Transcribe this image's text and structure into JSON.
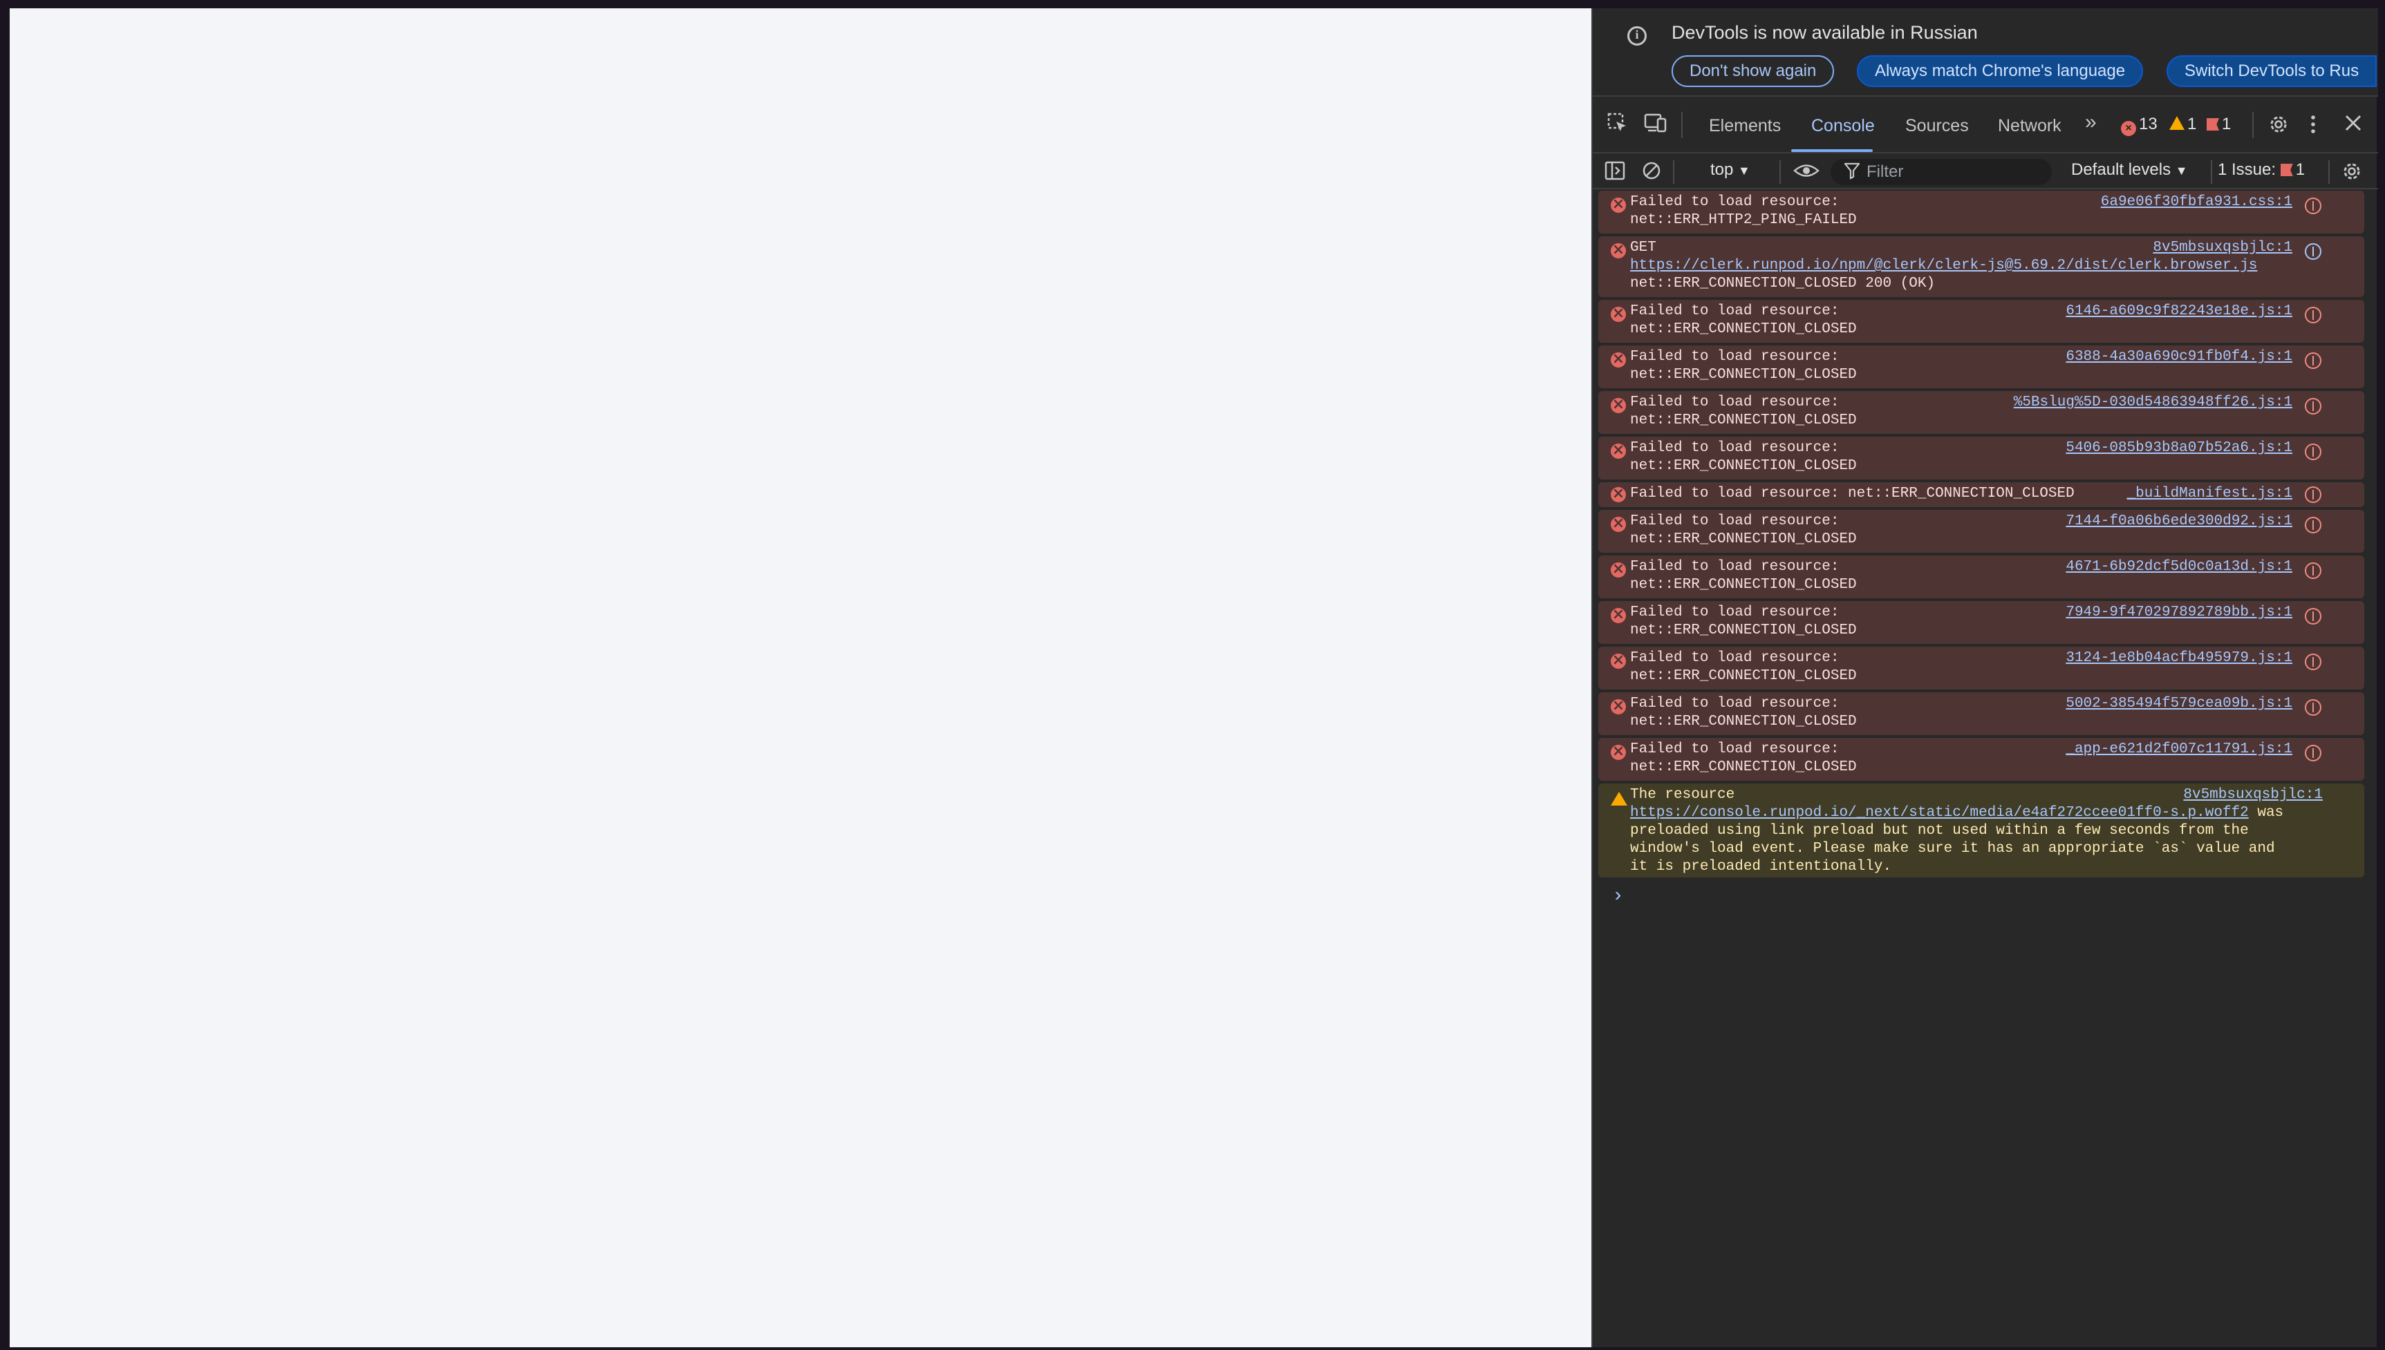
{
  "infobar": {
    "message": "DevTools is now available in Russian",
    "btn_dont_show": "Don't show again",
    "btn_match": "Always match Chrome's language",
    "btn_switch": "Switch DevTools to Rus"
  },
  "tabs": {
    "elements": "Elements",
    "console": "Console",
    "sources": "Sources",
    "network": "Network",
    "more": "»"
  },
  "counts": {
    "errors": "13",
    "warnings": "1",
    "issues": "1"
  },
  "console_toolbar": {
    "context": "top",
    "filter_placeholder": "Filter",
    "levels": "Default levels",
    "issues_label": "1 Issue:",
    "issues_count": "1"
  },
  "messages": [
    {
      "type": "error",
      "line1": "Failed to load resource:",
      "line2": "net::ERR_HTTP2_PING_FAILED",
      "source": "6a9e06f30fbfa931.css:1"
    },
    {
      "type": "error-get",
      "line1": "GET",
      "url": "https://clerk.runpod.io/npm/@clerk/clerk-js@5.69.2/dist/clerk.browser.js",
      "line3": "net::ERR_CONNECTION_CLOSED 200 (OK)",
      "source": "8v5mbsuxqsbjlc:1"
    },
    {
      "type": "error",
      "line1": "Failed to load resource:",
      "line2": "net::ERR_CONNECTION_CLOSED",
      "source": "6146-a609c9f82243e18e.js:1"
    },
    {
      "type": "error",
      "line1": "Failed to load resource:",
      "line2": "net::ERR_CONNECTION_CLOSED",
      "source": "6388-4a30a690c91fb0f4.js:1"
    },
    {
      "type": "error",
      "line1": "Failed to load resource:",
      "line2": "net::ERR_CONNECTION_CLOSED",
      "source": "%5Bslug%5D-030d54863948ff26.js:1"
    },
    {
      "type": "error",
      "line1": "Failed to load resource:",
      "line2": "net::ERR_CONNECTION_CLOSED",
      "source": "5406-085b93b8a07b52a6.js:1"
    },
    {
      "type": "error-single",
      "line1": "Failed to load resource: net::ERR_CONNECTION_CLOSED",
      "source": "_buildManifest.js:1"
    },
    {
      "type": "error",
      "line1": "Failed to load resource:",
      "line2": "net::ERR_CONNECTION_CLOSED",
      "source": "7144-f0a06b6ede300d92.js:1"
    },
    {
      "type": "error",
      "line1": "Failed to load resource:",
      "line2": "net::ERR_CONNECTION_CLOSED",
      "source": "4671-6b92dcf5d0c0a13d.js:1"
    },
    {
      "type": "error",
      "line1": "Failed to load resource:",
      "line2": "net::ERR_CONNECTION_CLOSED",
      "source": "7949-9f470297892789bb.js:1"
    },
    {
      "type": "error",
      "line1": "Failed to load resource:",
      "line2": "net::ERR_CONNECTION_CLOSED",
      "source": "3124-1e8b04acfb495979.js:1"
    },
    {
      "type": "error",
      "line1": "Failed to load resource:",
      "line2": "net::ERR_CONNECTION_CLOSED",
      "source": "5002-385494f579cea09b.js:1"
    },
    {
      "type": "error",
      "line1": "Failed to load resource:",
      "line2": "net::ERR_CONNECTION_CLOSED",
      "source": "_app-e621d2f007c11791.js:1"
    },
    {
      "type": "warning",
      "line1": "The resource",
      "url": "https://console.runpod.io/_next/static/media/e4af272ccee01ff0-s.p.woff2",
      "url_suffix": " was",
      "line3": "preloaded using link preload but not used within a few seconds from the",
      "line4": "window's load event. Please make sure it has an appropriate `as` value and",
      "line5": "it is preloaded intentionally.",
      "source": "8v5mbsuxqsbjlc:1"
    }
  ],
  "prompt_symbol": "›"
}
